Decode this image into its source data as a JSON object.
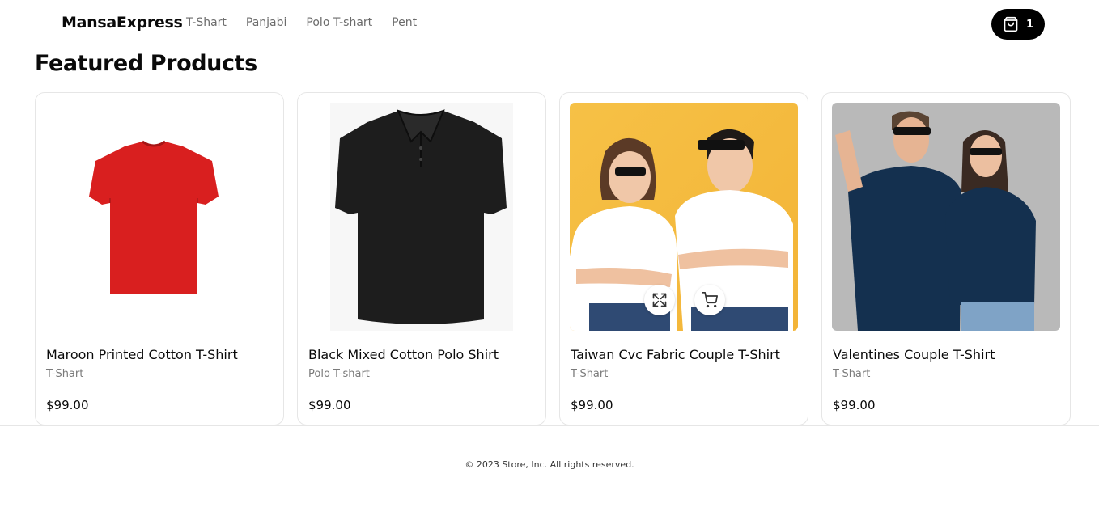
{
  "navbar": {
    "brand": "MansaExpress",
    "links": [
      "T-Shart",
      "Panjabi",
      "Polo T-shart",
      "Pent"
    ],
    "cart": {
      "icon": "shopping-bag-icon",
      "count": "1"
    }
  },
  "page": {
    "title": "Featured Products"
  },
  "products": [
    {
      "name": "Maroon Printed Cotton T-Shirt",
      "category": "T-Shart",
      "price": "$99.00",
      "image": "red-tshirt-photo"
    },
    {
      "name": "Black Mixed Cotton Polo Shirt",
      "category": "Polo T-shart",
      "price": "$99.00",
      "image": "black-polo-photo"
    },
    {
      "name": "Taiwan Cvc Fabric Couple T-Shirt",
      "category": "T-Shart",
      "price": "$99.00",
      "image": "couple-white-tshirts-photo",
      "hover_actions": [
        "expand-icon",
        "cart-icon"
      ]
    },
    {
      "name": "Valentines Couple T-Shirt",
      "category": "T-Shart",
      "price": "$99.00",
      "image": "king-queen-tshirts-photo"
    }
  ],
  "footer": {
    "text": "© 2023 Store, Inc. All rights reserved."
  },
  "colors": {
    "accent": "#000000",
    "muted_text": "#7a7a7a",
    "border": "#e6e6e6"
  }
}
